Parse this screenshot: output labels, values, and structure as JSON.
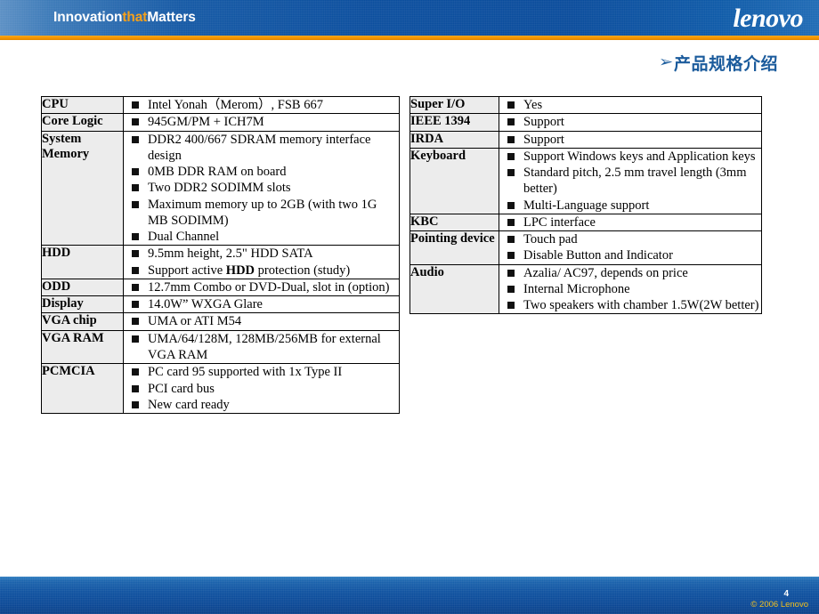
{
  "header": {
    "tagline_pre": "Innovation",
    "tagline_accent": "that",
    "tagline_post": "Matters",
    "logo": "lenovo",
    "brand_blue": "#0a4c9c",
    "accent_orange": "#f5a01b"
  },
  "title": {
    "arrow": "➢",
    "text": "产品规格介绍",
    "color": "#1b5b9c"
  },
  "left_table": {
    "rows": [
      {
        "label": "CPU",
        "items": [
          {
            "text": "Intel Yonah（Merom）, FSB 667"
          }
        ]
      },
      {
        "label": "Core Logic",
        "items": [
          {
            "text": "945GM/PM + ICH7M"
          }
        ]
      },
      {
        "label": "System Memory",
        "items": [
          {
            "text": "DDR2 400/667 SDRAM memory interface design"
          },
          {
            "text": "0MB DDR RAM on board"
          },
          {
            "text": "Two DDR2 SODIMM slots"
          },
          {
            "text": "Maximum memory up to 2GB (with two 1G MB SODIMM)"
          },
          {
            "text": "Dual Channel"
          }
        ]
      },
      {
        "label": "HDD",
        "items": [
          {
            "text": "9.5mm height, 2.5\" HDD SATA"
          },
          {
            "html": "Support active <b>HDD</b> protection (study)"
          }
        ]
      },
      {
        "label": "ODD",
        "items": [
          {
            "text": "12.7mm Combo or DVD-Dual, slot in (option)"
          }
        ]
      },
      {
        "label": "Display",
        "items": [
          {
            "text": "14.0W”  WXGA Glare"
          }
        ]
      },
      {
        "label": "VGA chip",
        "items": [
          {
            "text": "UMA or ATI M54"
          }
        ]
      },
      {
        "label": "VGA RAM",
        "items": [
          {
            "text": "UMA/64/128M, 128MB/256MB for external VGA RAM"
          }
        ]
      },
      {
        "label": "PCMCIA",
        "items": [
          {
            "text": "PC card 95 supported with 1x Type II"
          },
          {
            "text": "PCI card bus"
          },
          {
            "text": "New card ready"
          }
        ]
      }
    ]
  },
  "right_table": {
    "rows": [
      {
        "label": "Super I/O",
        "items": [
          {
            "text": "Yes"
          }
        ]
      },
      {
        "label": "IEEE 1394",
        "items": [
          {
            "text": "Support"
          }
        ]
      },
      {
        "label": "IRDA",
        "items": [
          {
            "text": "Support"
          }
        ]
      },
      {
        "label": "Keyboard",
        "items": [
          {
            "text": "Support Windows keys and Application keys"
          },
          {
            "text": "Standard pitch, 2.5 mm travel length (3mm better)"
          },
          {
            "text": "Multi-Language support"
          }
        ]
      },
      {
        "label": "KBC",
        "items": [
          {
            "text": "LPC interface"
          }
        ]
      },
      {
        "label": "Pointing device",
        "items": [
          {
            "text": "Touch pad"
          },
          {
            "text": "Disable Button and Indicator"
          }
        ]
      },
      {
        "label": "Audio",
        "items": [
          {
            "text": "Azalia/ AC97, depends on price"
          },
          {
            "text": "Internal Microphone"
          },
          {
            "text": "Two speakers with chamber 1.5W(2W better)"
          }
        ]
      }
    ]
  },
  "footer": {
    "page_number": "4",
    "copyright": "© 2006 Lenovo"
  }
}
